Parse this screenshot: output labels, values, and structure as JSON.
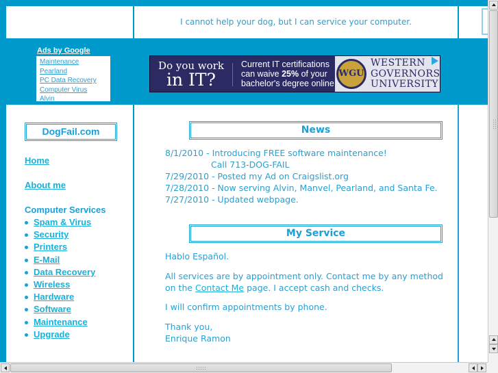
{
  "header": {
    "tagline": "I cannot help your dog, but I can service your computer."
  },
  "ads": {
    "title": "Ads by Google",
    "links": [
      "Maintenance",
      "Pearland",
      "PC Data Recovery",
      "Computer Virus",
      "Alvin"
    ]
  },
  "banner": {
    "left_line1": "Do you work",
    "left_line2": "in IT?",
    "mid_line1": "Current IT certifications",
    "mid_line2_pre": "can waive ",
    "mid_line2_bold": "25%",
    "mid_line2_post": " of your",
    "mid_line3": "bachelor's degree online.",
    "seal_text": "WGU",
    "brand_line1": "WESTERN",
    "brand_line2": "GOVERNORS",
    "brand_line3": "UNIVERSITY",
    "adchoices_icon": "adchoices-triangle-icon"
  },
  "sidebar": {
    "logo": "DogFail.com",
    "home": "Home",
    "about": "About me",
    "services_heading": "Computer Services",
    "services": [
      "Spam & Virus",
      "Security",
      "Printers",
      "E-Mail",
      "Data Recovery",
      "Wireless",
      "Hardware",
      "Software",
      "Maintenance",
      "Upgrade"
    ]
  },
  "news": {
    "title": "News",
    "items": [
      "8/1/2010 - Introducing FREE software maintenance!",
      "Call 713-DOG-FAIL",
      "7/29/2010 - Posted my Ad on Craigslist.org",
      "7/28/2010 - Now serving Alvin, Manvel, Pearland, and Santa Fe.",
      "7/27/2010 - Updated webpage."
    ]
  },
  "service": {
    "title": "My Service",
    "p1": "Hablo Español.",
    "p2_pre": "All services are by appointment only. Contact me by any method on the ",
    "p2_link": "Contact Me",
    "p2_post": " page. I accept cash and checks.",
    "p3": "I will confirm appointments by phone.",
    "p4_line1": "Thank you,",
    "p4_line2": "Enrique Ramon"
  },
  "colors": {
    "page_background": "#0099cc",
    "accent_text": "#2a9fd0",
    "link": "#1ab0d8",
    "banner_navy": "#2b2a63"
  }
}
